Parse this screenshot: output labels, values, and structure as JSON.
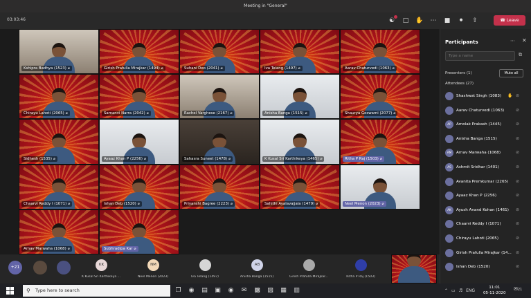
{
  "window": {
    "title": "Meeting in \"General\""
  },
  "toolbar": {
    "timer": "03:03:46",
    "leave_label": "Leave"
  },
  "tiles": [
    {
      "name": "Kshipra Badhya (1523)",
      "bg": "room"
    },
    {
      "name": "Girish Prafulla Mirajkar (1494)",
      "bg": "diwali"
    },
    {
      "name": "Suhani Deo (2041)",
      "bg": "diwali"
    },
    {
      "name": "Iva Telang (1497)",
      "bg": "diwali"
    },
    {
      "name": "Aarav Chaturvedi (1063)",
      "bg": "diwali"
    },
    {
      "name": "Chirayu Lahoti (2065)",
      "bg": "diwali"
    },
    {
      "name": "Samanvi Narra (2042)",
      "bg": "diwali"
    },
    {
      "name": "Rachel Varghese (2167)",
      "bg": "room"
    },
    {
      "name": "Anisha Banga (1515)",
      "bg": "bright"
    },
    {
      "name": "Shaurya Goswami (2077)",
      "bg": "diwali"
    },
    {
      "name": "Sidhesh (1535)",
      "bg": "diwali"
    },
    {
      "name": "Ayaaz Khan P (2256)",
      "bg": "bright"
    },
    {
      "name": "Sahasra Suneet (1478)",
      "bg": "dim"
    },
    {
      "name": "K Kusal Sri Karthikeya (1465)",
      "bg": "bright"
    },
    {
      "name": "Ritha P Raj (1503)",
      "bg": "diwali"
    },
    {
      "name": "Chaarvi Reddy I (1071)",
      "bg": "diwali"
    },
    {
      "name": "Ishan Deb (1520)",
      "bg": "diwali"
    },
    {
      "name": "Priyanshi Bagree (2223)",
      "bg": "diwali"
    },
    {
      "name": "Sahithi Ayalavajjala (1479)",
      "bg": "diwali"
    },
    {
      "name": "Neel Menon (2023)",
      "bg": "bright"
    },
    {
      "name": "Arnav Marwaha (1068)",
      "bg": "diwali"
    },
    {
      "name": "Subhradipa Kar",
      "bg": "diwali"
    }
  ],
  "participants_panel": {
    "title": "Participants",
    "search_placeholder": "Type a name",
    "presenters_label": "Presenters (1)",
    "mute_all_label": "Mute all",
    "attendees_label": "Attendees (27)",
    "attendees": [
      {
        "initials": "",
        "name": "Shashwat Singh (1083)",
        "hand": true
      },
      {
        "initials": "",
        "name": "Aarav Chaturvedi (1063)"
      },
      {
        "initials": "AP",
        "name": "Amolak Prakash (1445)"
      },
      {
        "initials": "",
        "name": "Anisha Banga (1515)"
      },
      {
        "initials": "AM",
        "name": "Arnav Marwaha (1068)"
      },
      {
        "initials": "AS",
        "name": "Ashmit Sridhar (1401)"
      },
      {
        "initials": "",
        "name": "Avanita Premkumar (2265)"
      },
      {
        "initials": "",
        "name": "Ayaaz Khan P (2256)"
      },
      {
        "initials": "AK",
        "name": "Ayush Anand Kohan (1461)"
      },
      {
        "initials": "",
        "name": "Chaarvi Reddy I (1071)"
      },
      {
        "initials": "",
        "name": "Chirayu Lahoti (2065)"
      },
      {
        "initials": "",
        "name": "Girish Prafulla Mirajkar (14..."
      },
      {
        "initials": "",
        "name": "Ishan Deb (1520)"
      }
    ]
  },
  "strip": {
    "more_count": "+21",
    "thumbs": [
      {
        "initials": "KK",
        "label": "K Kusal Sri Karthikeya ...",
        "color": "#e8d8d8"
      },
      {
        "initials": "NM",
        "label": "Neel Menon (2023)",
        "color": "#f3d9b8"
      },
      {
        "initials": "",
        "label": "Iva Telang (1497)",
        "color": "#d6d6d6"
      },
      {
        "initials": "AB",
        "label": "Anisha Banga (1515)",
        "color": "#cfd3e8"
      },
      {
        "initials": "",
        "label": "Girish Prafulla Mirajkar...",
        "color": "#a9a9a9"
      },
      {
        "initials": "",
        "label": "Ritha P Raj (1503)",
        "color": "#2f3ea8"
      }
    ]
  },
  "taskbar": {
    "search_placeholder": "Type here to search",
    "lang": "ENG",
    "time": "11:01",
    "date": "05-11-2020",
    "notifications": "21"
  }
}
